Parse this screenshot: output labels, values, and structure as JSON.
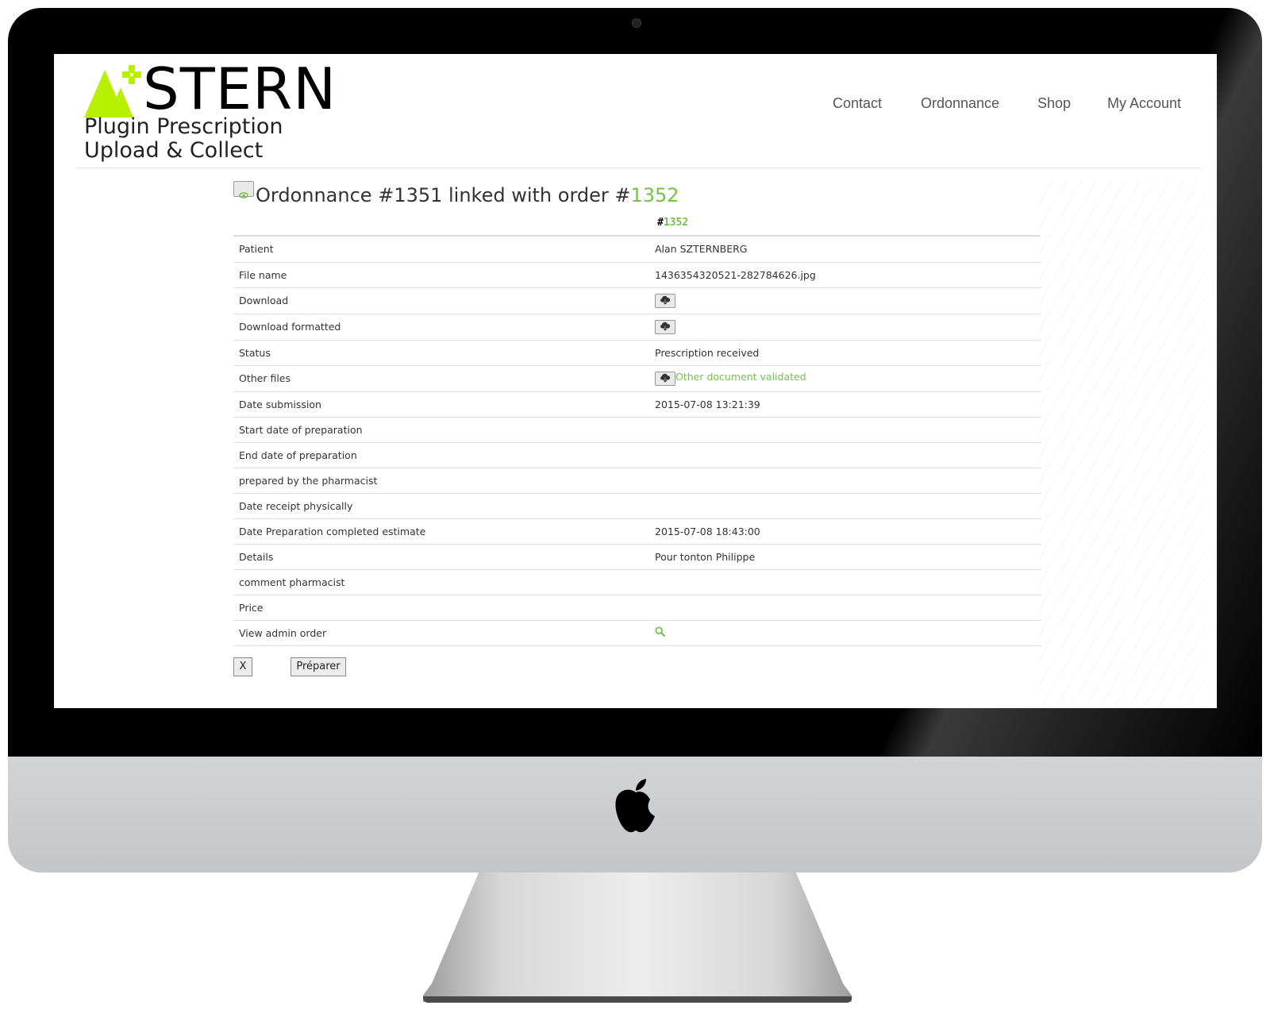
{
  "logo": {
    "brand": "STERN",
    "line1": "Plugin Prescription",
    "line2": "Upload & Collect",
    "accent_color": "#b7f000"
  },
  "nav": [
    "Contact",
    "Ordonnance",
    "Shop",
    "My Account"
  ],
  "title": {
    "prefix": "Ordonnance #1351 linked with order #",
    "order_number": "1352",
    "icon": "eye-icon"
  },
  "table": {
    "header_hash": "#",
    "header_order": "1352",
    "rows": [
      {
        "label": "Patient",
        "value": "Alan SZTERNBERG"
      },
      {
        "label": "File name",
        "value": "1436354320521-282784626.jpg"
      },
      {
        "label": "Download",
        "value": "",
        "icon": "cloud-download-icon"
      },
      {
        "label": "Download formatted",
        "value": "",
        "icon": "cloud-download-icon"
      },
      {
        "label": "Status",
        "value": "Prescription received"
      },
      {
        "label": "Other files",
        "value": "Other document validated",
        "icon": "cloud-download-icon"
      },
      {
        "label": "Date submission",
        "value": "2015-07-08 13:21:39"
      },
      {
        "label": "Start date of preparation",
        "value": ""
      },
      {
        "label": "End date of preparation",
        "value": ""
      },
      {
        "label": "prepared by the pharmacist",
        "value": ""
      },
      {
        "label": "Date receipt physically",
        "value": ""
      },
      {
        "label": "Date Preparation completed estimate",
        "value": "2015-07-08 18:43:00"
      },
      {
        "label": "Details",
        "value": "Pour tonton Philippe"
      },
      {
        "label": "comment pharmacist",
        "value": ""
      },
      {
        "label": "Price",
        "value": ""
      },
      {
        "label": "View admin order",
        "value": "",
        "icon": "search-icon"
      }
    ]
  },
  "buttons": {
    "close": "X",
    "prepare": "Préparer"
  },
  "colors": {
    "link_green": "#74c24a",
    "nav_text": "#555555"
  }
}
